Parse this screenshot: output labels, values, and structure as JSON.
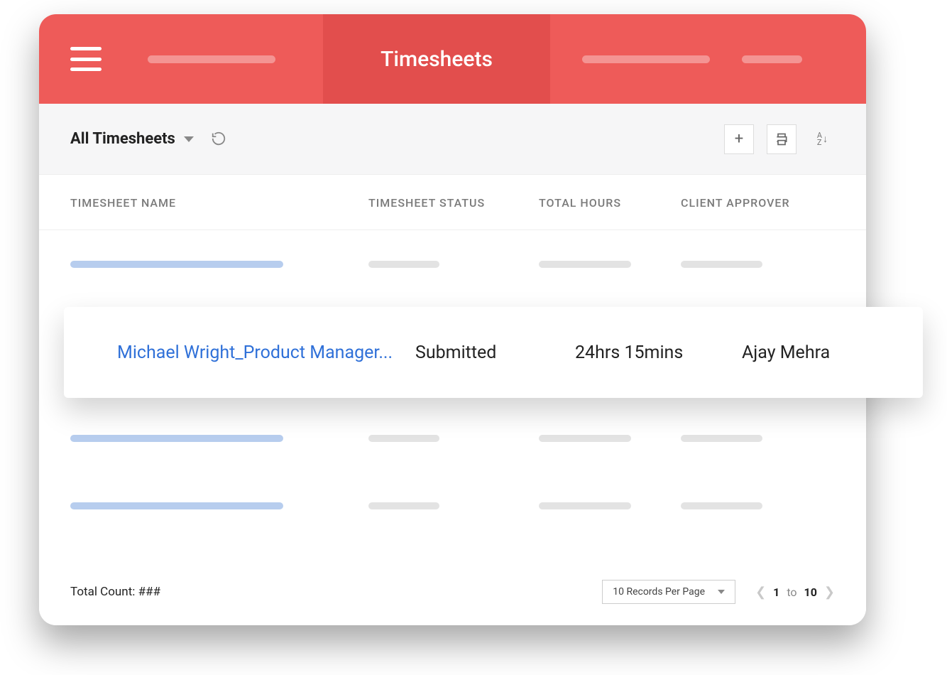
{
  "header": {
    "title": "Timesheets"
  },
  "toolbar": {
    "filter_label": "All Timesheets"
  },
  "columns": {
    "name": "TIMESHEET NAME",
    "status": "TIMESHEET STATUS",
    "hours": "TOTAL HOURS",
    "approver": "CLIENT APPROVER"
  },
  "highlighted_row": {
    "name": "Michael Wright_Product Manager...",
    "status": "Submitted",
    "hours": "24hrs 15mins",
    "approver": "Ajay Mehra"
  },
  "footer": {
    "total_count_label": "Total Count: ###",
    "per_page_label": "10 Records Per Page",
    "page_from": "1",
    "page_to_word": "to",
    "page_to": "10"
  }
}
